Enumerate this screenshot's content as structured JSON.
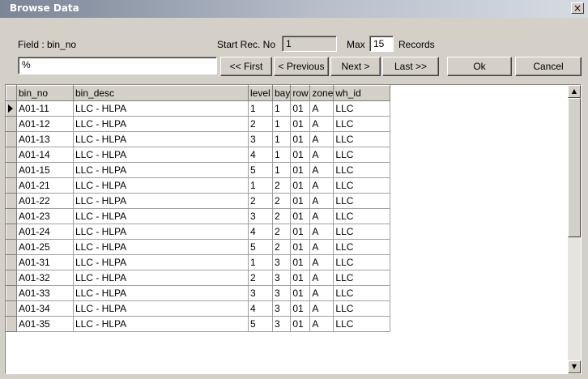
{
  "window": {
    "title": "Browse Data",
    "close_glyph": "×"
  },
  "toolbar": {
    "field_label": "Field : bin_no",
    "start_rec_label": "Start Rec. No",
    "start_rec_value": "1",
    "max_label": "Max",
    "max_value": "15",
    "records_label": "Records",
    "search_value": "%",
    "first_label": "<< First",
    "previous_label": "< Previous",
    "next_label": "Next >",
    "last_label": "Last >>",
    "ok_label": "Ok",
    "cancel_label": "Cancel"
  },
  "grid": {
    "columns": [
      "bin_no",
      "bin_desc",
      "level",
      "bay",
      "row",
      "zone",
      "wh_id"
    ],
    "rows": [
      [
        "A01-11",
        "LLC - HLPA",
        "1",
        "1",
        "01",
        "A",
        "LLC"
      ],
      [
        "A01-12",
        "LLC - HLPA",
        "2",
        "1",
        "01",
        "A",
        "LLC"
      ],
      [
        "A01-13",
        "LLC - HLPA",
        "3",
        "1",
        "01",
        "A",
        "LLC"
      ],
      [
        "A01-14",
        "LLC - HLPA",
        "4",
        "1",
        "01",
        "A",
        "LLC"
      ],
      [
        "A01-15",
        "LLC - HLPA",
        "5",
        "1",
        "01",
        "A",
        "LLC"
      ],
      [
        "A01-21",
        "LLC - HLPA",
        "1",
        "2",
        "01",
        "A",
        "LLC"
      ],
      [
        "A01-22",
        "LLC - HLPA",
        "2",
        "2",
        "01",
        "A",
        "LLC"
      ],
      [
        "A01-23",
        "LLC - HLPA",
        "3",
        "2",
        "01",
        "A",
        "LLC"
      ],
      [
        "A01-24",
        "LLC - HLPA",
        "4",
        "2",
        "01",
        "A",
        "LLC"
      ],
      [
        "A01-25",
        "LLC - HLPA",
        "5",
        "2",
        "01",
        "A",
        "LLC"
      ],
      [
        "A01-31",
        "LLC - HLPA",
        "1",
        "3",
        "01",
        "A",
        "LLC"
      ],
      [
        "A01-32",
        "LLC - HLPA",
        "2",
        "3",
        "01",
        "A",
        "LLC"
      ],
      [
        "A01-33",
        "LLC - HLPA",
        "3",
        "3",
        "01",
        "A",
        "LLC"
      ],
      [
        "A01-34",
        "LLC - HLPA",
        "4",
        "3",
        "01",
        "A",
        "LLC"
      ],
      [
        "A01-35",
        "LLC - HLPA",
        "5",
        "3",
        "01",
        "A",
        "LLC"
      ]
    ],
    "selected_row": 0
  },
  "icons": {
    "close": "close-icon",
    "row_indicator": "row-pointer-icon",
    "scroll_up": "scroll-up-arrow-icon",
    "scroll_down": "scroll-down-arrow-icon"
  }
}
